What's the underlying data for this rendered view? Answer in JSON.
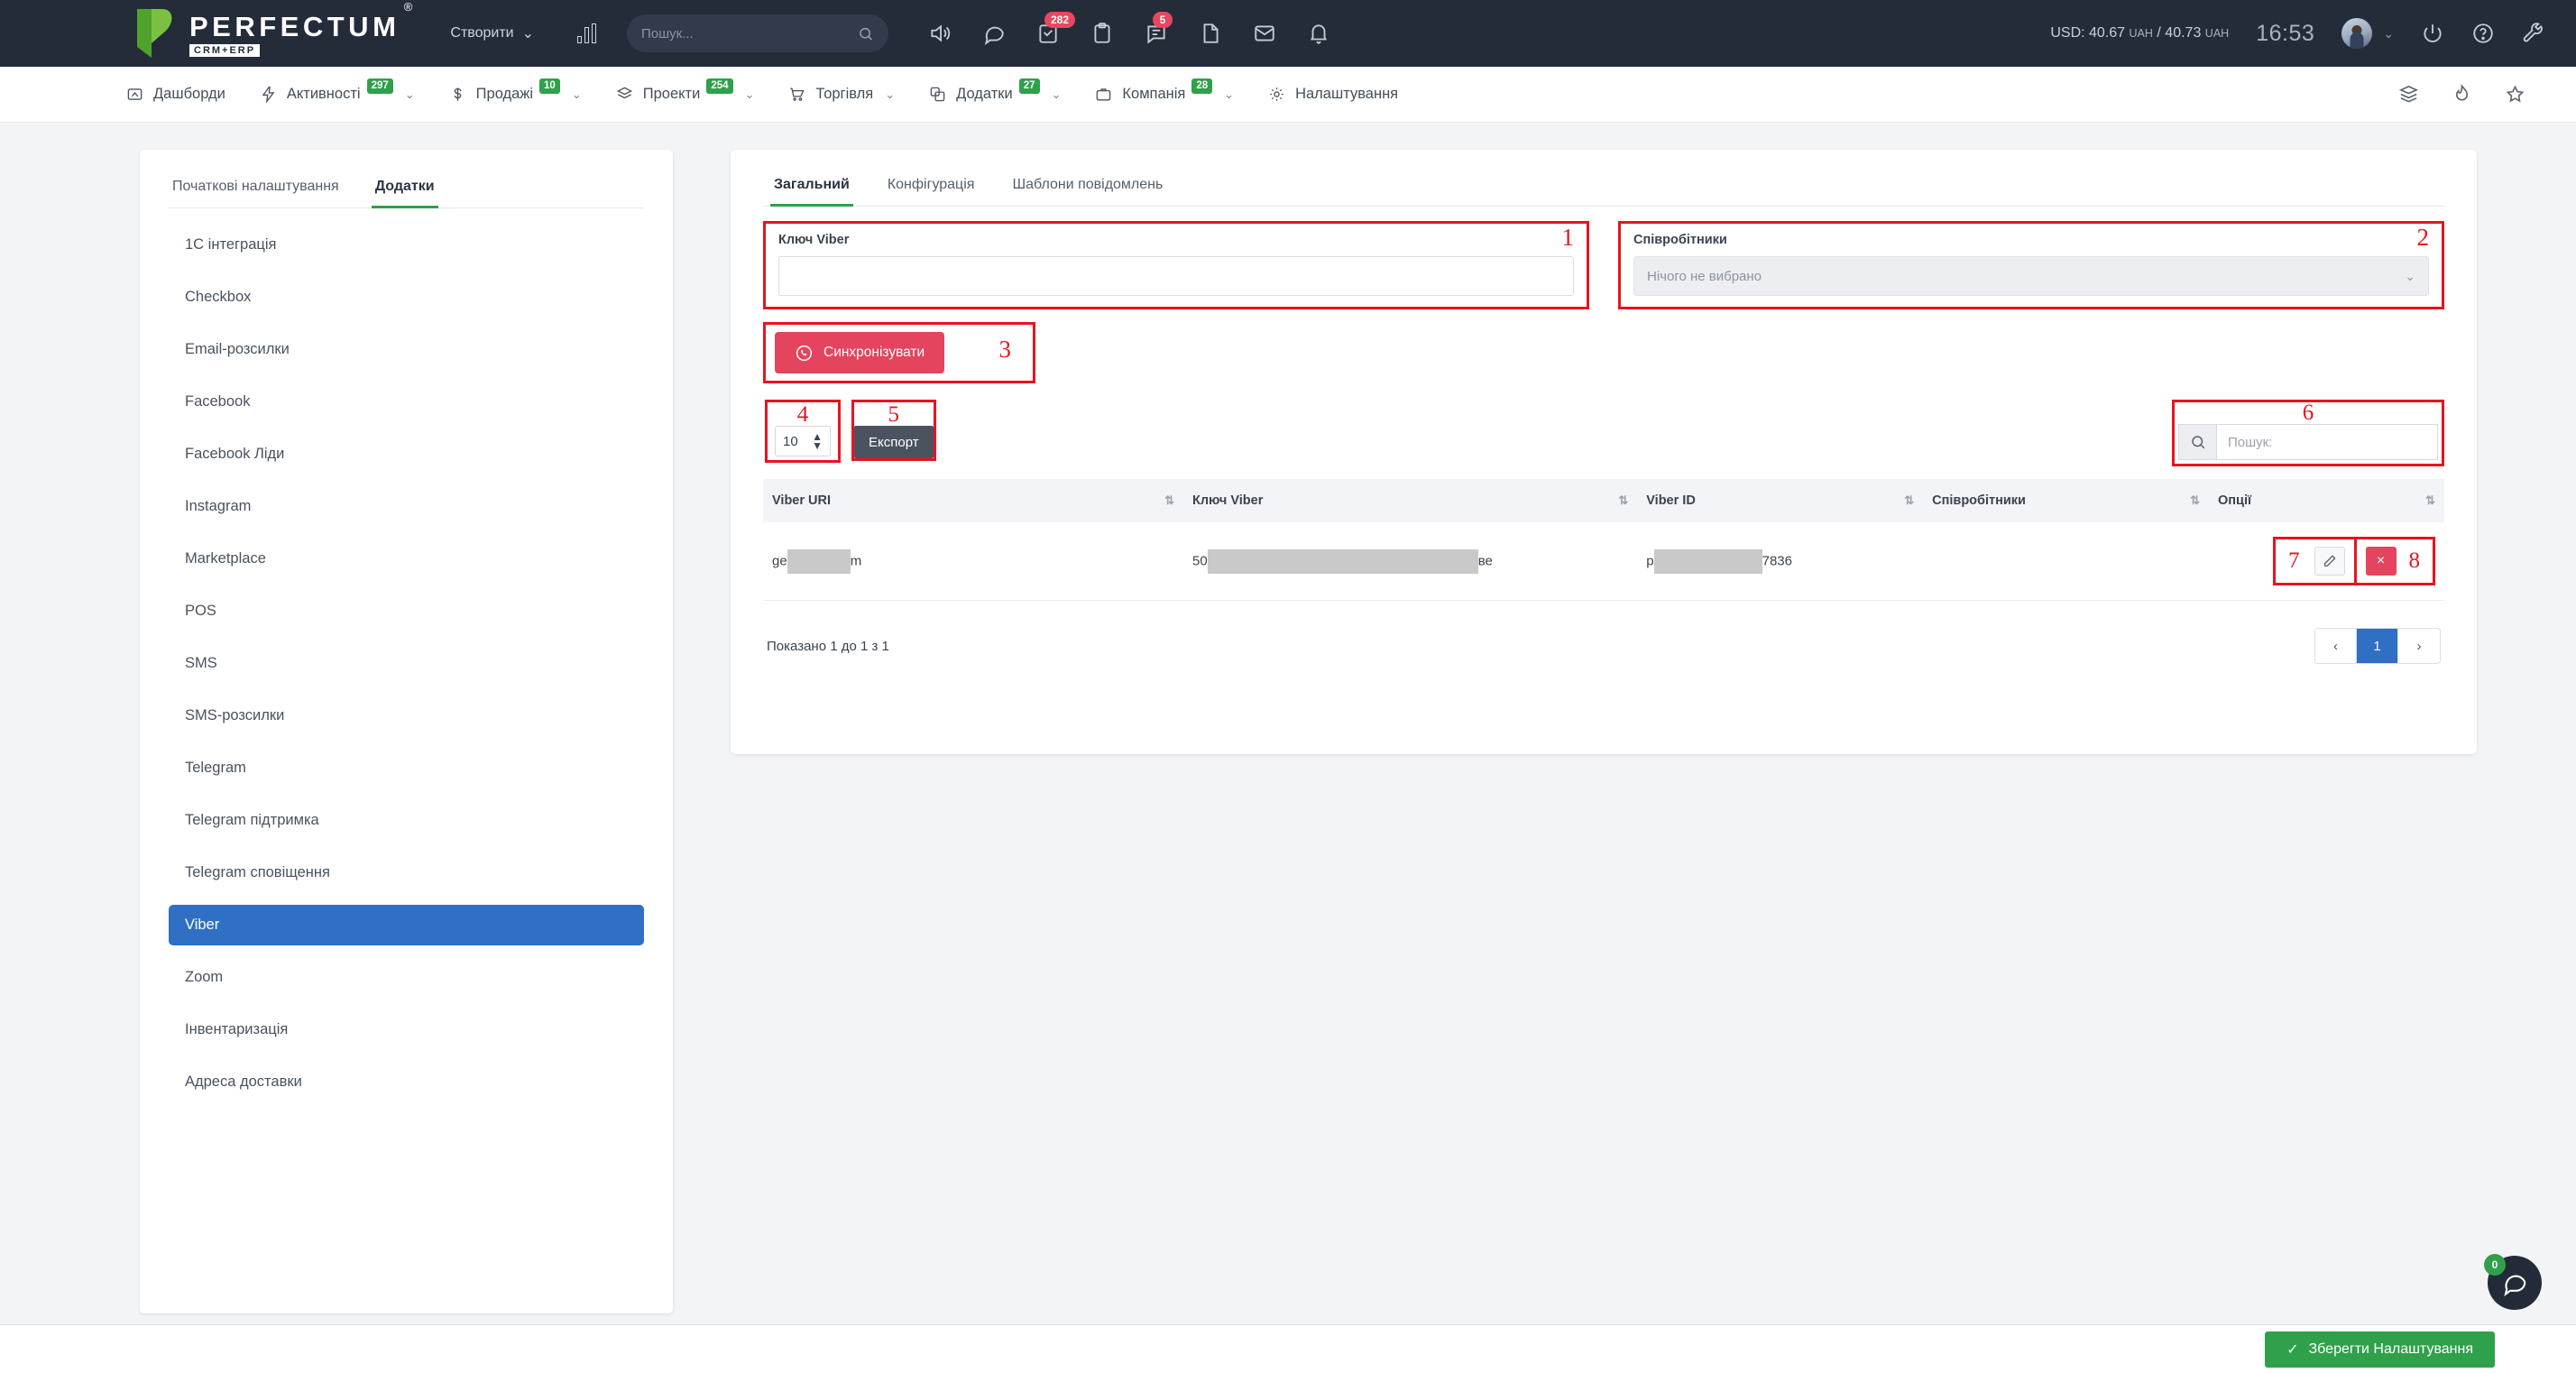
{
  "topbar": {
    "logo_name": "PERFECTUM",
    "logo_registered": "®",
    "logo_sub": "CRM+ERP",
    "create_label": "Створити",
    "create_caret": "⌄",
    "search_placeholder": "Пошук...",
    "icons": [
      {
        "name": "volume-icon",
        "badge": null
      },
      {
        "name": "chat-bubble-icon",
        "badge": null
      },
      {
        "name": "task-checklist-icon",
        "badge": "282"
      },
      {
        "name": "clipboard-icon",
        "badge": null
      },
      {
        "name": "comment-icon",
        "badge": "5"
      },
      {
        "name": "document-icon",
        "badge": null
      },
      {
        "name": "mail-icon",
        "badge": null
      },
      {
        "name": "bell-icon",
        "badge": null
      }
    ],
    "rate_label": "USD:",
    "rate_buy": "40.67",
    "rate_cur1": "UAH",
    "rate_sep": "/",
    "rate_sell": "40.73",
    "rate_cur2": "UAH",
    "clock": "16:53",
    "avatar_caret": "⌄"
  },
  "nav": {
    "items": [
      {
        "label": "Дашборди",
        "icon": "dashboard-icon",
        "badge": null,
        "caret": false
      },
      {
        "label": "Активності",
        "icon": "lightning-icon",
        "badge": "297",
        "caret": true
      },
      {
        "label": "Продажі",
        "icon": "dollar-icon",
        "badge": "10",
        "caret": true
      },
      {
        "label": "Проекти",
        "icon": "layers-icon",
        "badge": "254",
        "caret": true
      },
      {
        "label": "Торгівля",
        "icon": "cart-icon",
        "badge": null,
        "caret": true
      },
      {
        "label": "Додатки",
        "icon": "apps-icon",
        "badge": "27",
        "caret": true
      },
      {
        "label": "Компанія",
        "icon": "briefcase-icon",
        "badge": "28",
        "caret": true
      },
      {
        "label": "Налаштування",
        "icon": "gear-icon",
        "badge": null,
        "caret": false
      }
    ],
    "right_icons": [
      "layers-stack-icon",
      "flame-icon",
      "star-icon"
    ],
    "caret_glyph": "⌄"
  },
  "sidebar": {
    "tabs": [
      {
        "label": "Початкові налаштування",
        "active": false
      },
      {
        "label": "Додатки",
        "active": true
      }
    ],
    "items": [
      {
        "label": "1С інтеграція",
        "active": false
      },
      {
        "label": "Checkbox",
        "active": false
      },
      {
        "label": "Email-розсилки",
        "active": false
      },
      {
        "label": "Facebook",
        "active": false
      },
      {
        "label": "Facebook Ліди",
        "active": false
      },
      {
        "label": "Instagram",
        "active": false
      },
      {
        "label": "Marketplace",
        "active": false
      },
      {
        "label": "POS",
        "active": false
      },
      {
        "label": "SMS",
        "active": false
      },
      {
        "label": "SMS-розсилки",
        "active": false
      },
      {
        "label": "Telegram",
        "active": false
      },
      {
        "label": "Telegram підтримка",
        "active": false
      },
      {
        "label": "Telegram сповіщення",
        "active": false
      },
      {
        "label": "Viber",
        "active": true
      },
      {
        "label": "Zoom",
        "active": false
      },
      {
        "label": "Інвентаризація",
        "active": false
      },
      {
        "label": "Адреса доставки",
        "active": false
      }
    ]
  },
  "main": {
    "tabs": [
      {
        "label": "Загальний",
        "active": true
      },
      {
        "label": "Конфігурація",
        "active": false
      },
      {
        "label": "Шаблони повідомлень",
        "active": false
      }
    ],
    "viber_key": {
      "label": "Ключ Viber",
      "value": "",
      "marker": "1"
    },
    "employees": {
      "label": "Співробітники",
      "selected": "Нічого не вибрано",
      "caret": "⌄",
      "marker": "2"
    },
    "sync_button": {
      "label": "Синхронізувати",
      "icon": "viber-icon",
      "marker": "3"
    },
    "page_size": {
      "value": "10",
      "marker": "4"
    },
    "export_button": {
      "label": "Експорт",
      "marker": "5"
    },
    "table_search": {
      "placeholder": "Пошук:",
      "value": "",
      "icon": "search-icon",
      "marker": "6"
    },
    "table": {
      "columns": [
        "Viber URI",
        "Ключ Viber",
        "Viber ID",
        "Співробітники",
        "Опції"
      ],
      "sort_glyph": "⇅",
      "rows": [
        {
          "viber_uri_prefix": "ge",
          "viber_uri_suffix": "m",
          "viber_key_prefix": "50",
          "viber_key_suffix": "ве",
          "viber_id_prefix": "p",
          "viber_id_suffix": "7836",
          "employees": ""
        }
      ],
      "edit_icon": "pencil-icon",
      "edit_marker": "7",
      "delete_icon": "close-icon",
      "delete_glyph": "×",
      "delete_marker": "8"
    },
    "shown_text": "Показано 1 до 1 з 1",
    "pagination": {
      "prev": "‹",
      "pages": [
        "1"
      ],
      "next": "›",
      "current": "1"
    }
  },
  "footer": {
    "save_label": "Зберегти Налаштування",
    "save_check": "✓",
    "chat_count": "0",
    "chat_icon": "chat-bubble-icon"
  },
  "colors": {
    "topbar_bg": "#242c3a",
    "accent_green": "#2fa14b",
    "accent_blue": "#2f6fc4",
    "accent_red": "#e4445d",
    "marker_red": "#e8131f",
    "badge_red": "#e8475f"
  }
}
